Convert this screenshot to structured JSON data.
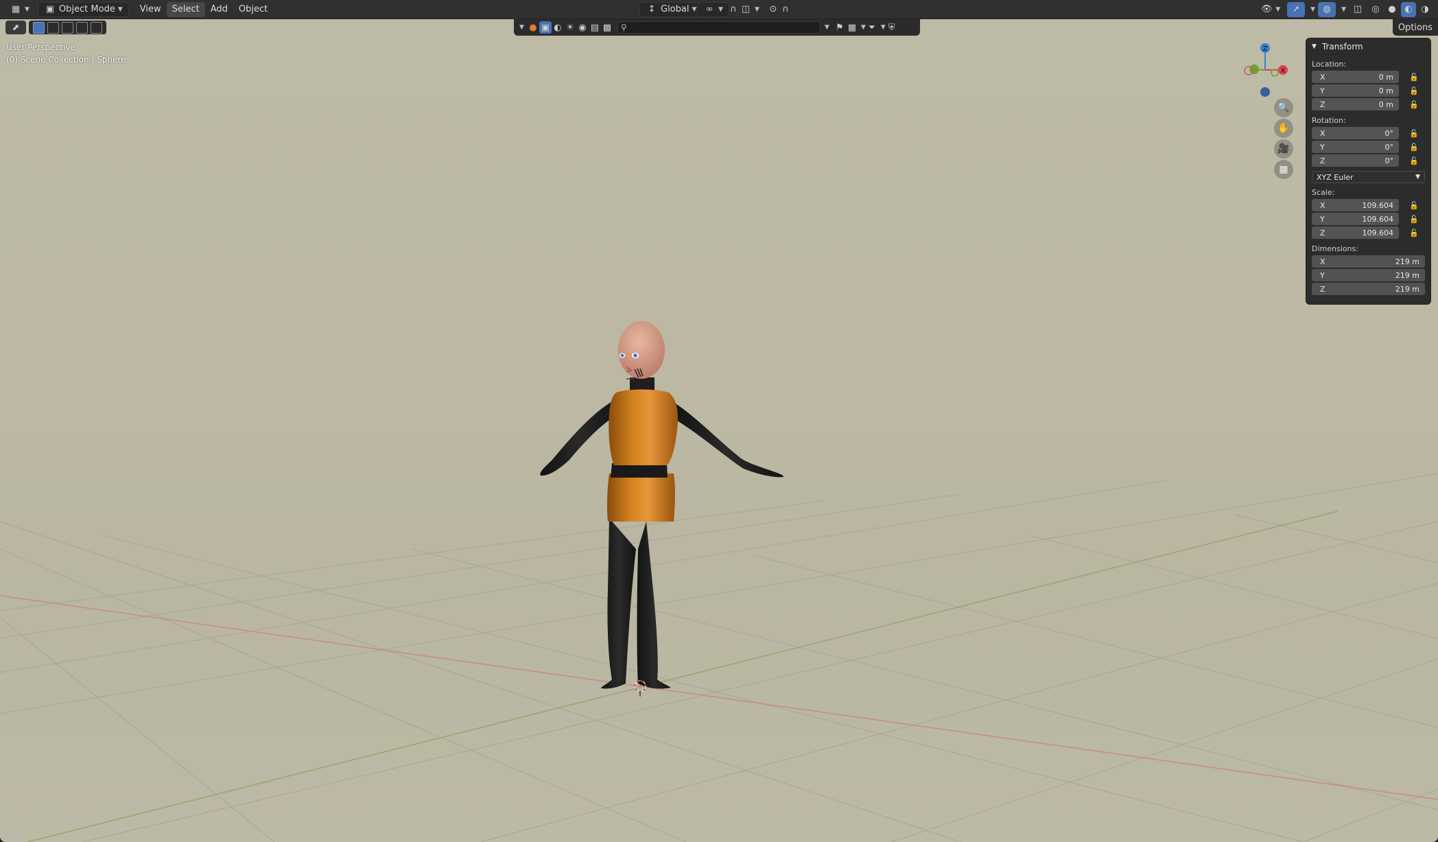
{
  "header": {
    "editor_icon": "view3d-icon",
    "mode": "Object Mode",
    "menus": [
      "View",
      "Select",
      "Add",
      "Object"
    ],
    "active_menu": "Select",
    "orientation": "Global"
  },
  "toolbar": {
    "options_label": "Options",
    "search_placeholder": ""
  },
  "viewport": {
    "perspective": "User Perspective",
    "collection_info": "(0) Scene Collection | Sphere"
  },
  "gizmo": {
    "x_label": "X",
    "y_label": "Y",
    "z_label": "Z",
    "colors": {
      "x": "#e04050",
      "y": "#6ea22f",
      "z": "#3a7fd6"
    }
  },
  "transform": {
    "title": "Transform",
    "location_label": "Location:",
    "location": [
      {
        "axis": "X",
        "value": "0 m"
      },
      {
        "axis": "Y",
        "value": "0 m"
      },
      {
        "axis": "Z",
        "value": "0 m"
      }
    ],
    "rotation_label": "Rotation:",
    "rotation": [
      {
        "axis": "X",
        "value": "0°"
      },
      {
        "axis": "Y",
        "value": "0°"
      },
      {
        "axis": "Z",
        "value": "0°"
      }
    ],
    "rotation_mode": "XYZ Euler",
    "scale_label": "Scale:",
    "scale": [
      {
        "axis": "X",
        "value": "109.604"
      },
      {
        "axis": "Y",
        "value": "109.604"
      },
      {
        "axis": "Z",
        "value": "109.604"
      }
    ],
    "dimensions_label": "Dimensions:",
    "dimensions": [
      {
        "axis": "X",
        "value": "219 m"
      },
      {
        "axis": "Y",
        "value": "219 m"
      },
      {
        "axis": "Z",
        "value": "219 m"
      }
    ]
  },
  "colors": {
    "background": "#bcb9a5",
    "header": "#303030",
    "panel": "#2c2c2c",
    "field": "#545454",
    "accent": "#4772b3",
    "outfit": "#c27418",
    "suit": "#1b1b1b",
    "skin": "#d49a82"
  }
}
